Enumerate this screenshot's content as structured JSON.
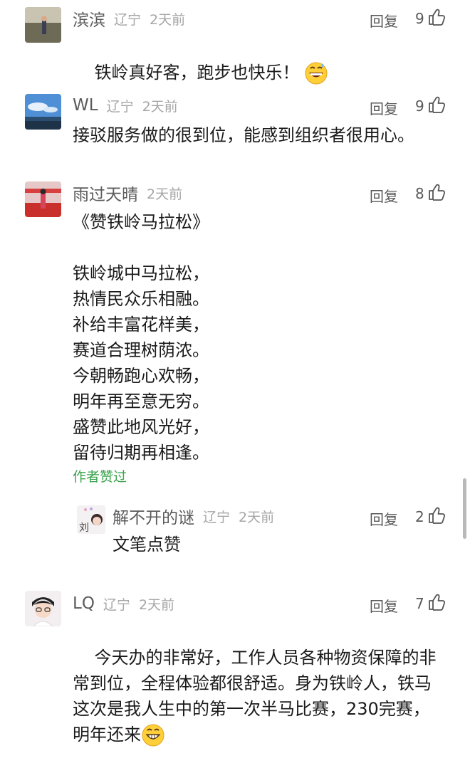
{
  "colors": {
    "accent_green": "#3aa34b",
    "meta_gray": "#a6a6a6",
    "nick_gray": "#5b5b5b"
  },
  "comments": [
    {
      "nickname": "滨滨",
      "location": "辽宁",
      "time": "2天前",
      "reply_label": "回复",
      "likes": "9",
      "text": "铁岭真好客，跑步也快乐！",
      "emoji": "grinning-face-sweat-emoji"
    },
    {
      "nickname": "WL",
      "location": "辽宁",
      "time": "2天前",
      "reply_label": "回复",
      "likes": "9",
      "text": "接驳服务做的很到位，能感到组织者很用心。"
    },
    {
      "nickname": "雨过天晴",
      "time": "2天前",
      "reply_label": "回复",
      "likes": "8",
      "text": "《赞铁岭马拉松》\n\n铁岭城中马拉松，\n热情民众乐相融。\n补给丰富花样美，\n赛道合理树荫浓。\n今朝畅跑心欢畅，\n明年再至意无穷。\n盛赞此地风光好，\n留待归期再相逢。",
      "author_liked": "作者赞过",
      "reply": {
        "nickname": "解不开的谜",
        "location": "辽宁",
        "time": "2天前",
        "reply_label": "回复",
        "likes": "2",
        "avatar_text": "刘",
        "text": "文笔点赞"
      }
    },
    {
      "nickname": "LQ",
      "location": "辽宁",
      "time": "2天前",
      "reply_label": "回复",
      "likes": "7",
      "text": "今天办的非常好，工作人员各种物资保障的非常到位，全程体验都很舒适。身为铁岭人，铁马这次是我人生中的第一次半马比赛，230完赛，明年还来",
      "emoji": "grinning-face-emoji"
    }
  ]
}
